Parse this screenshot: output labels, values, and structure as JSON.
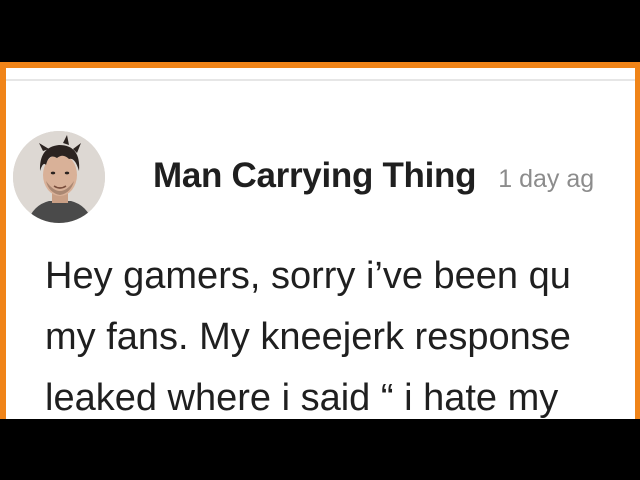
{
  "post": {
    "author": "Man Carrying Thing",
    "timestamp": "1 day ag",
    "body_lines": [
      "Hey gamers, sorry i’ve been qu",
      "my fans. My kneejerk response",
      "leaked where i said “ i hate my"
    ]
  },
  "colors": {
    "frame_border": "#f08418",
    "background": "#000000",
    "card": "#ffffff",
    "author_text": "#1f1f1f",
    "timestamp_text": "#8c8c8c"
  },
  "icons": {
    "avatar": "profile-photo"
  }
}
